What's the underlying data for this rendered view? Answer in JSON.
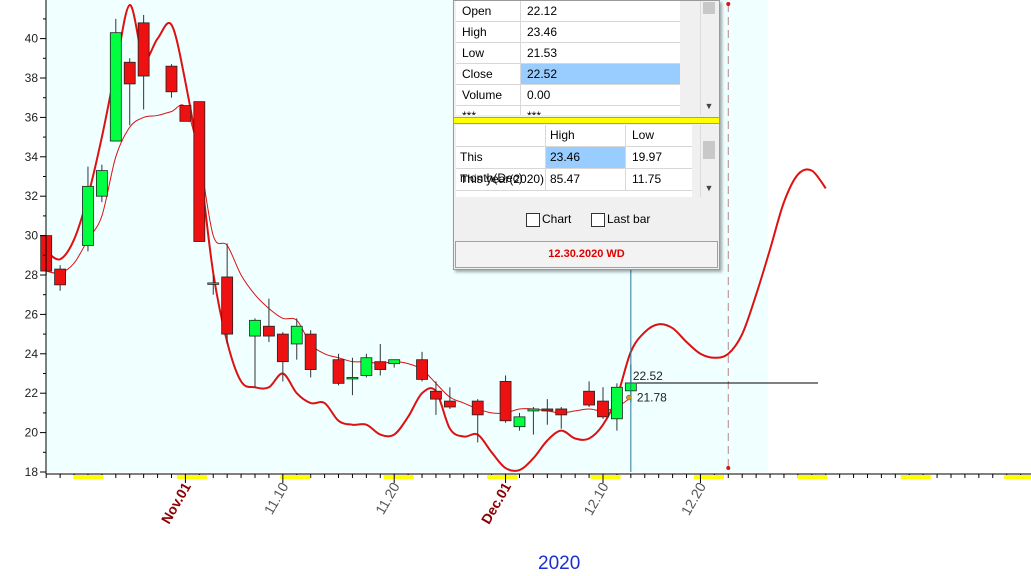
{
  "chart_data": {
    "type": "candlestick",
    "year_label": "2020",
    "yaxis": {
      "ticks": [
        18,
        20,
        22,
        24,
        26,
        28,
        30,
        32,
        34,
        36,
        38,
        40
      ],
      "ylim": [
        17.9,
        41.9
      ]
    },
    "xaxis": {
      "tick_labels": [
        {
          "label": "Nov.01",
          "color": "#8b0000",
          "day": 10
        },
        {
          "label": "11.10",
          "color": "#555555",
          "day": 17
        },
        {
          "label": "11.20",
          "color": "#555555",
          "day": 25
        },
        {
          "label": "Dec.01",
          "color": "#8b0000",
          "day": 33
        },
        {
          "label": "12.10",
          "color": "#555555",
          "day": 40
        },
        {
          "label": "12.20",
          "color": "#555555",
          "day": 47
        }
      ]
    },
    "candles": [
      {
        "day": 0,
        "o": 30.0,
        "h": 30.0,
        "l": 28.0,
        "c": 28.2
      },
      {
        "day": 1,
        "o": 28.3,
        "h": 28.5,
        "l": 27.2,
        "c": 27.5
      },
      {
        "day": 3,
        "o": 29.5,
        "h": 33.5,
        "l": 29.2,
        "c": 32.5
      },
      {
        "day": 4,
        "o": 32.0,
        "h": 33.6,
        "l": 31.7,
        "c": 33.3
      },
      {
        "day": 5,
        "o": 34.8,
        "h": 41.0,
        "l": 34.8,
        "c": 40.3
      },
      {
        "day": 6,
        "o": 38.8,
        "h": 39.0,
        "l": 35.6,
        "c": 37.7
      },
      {
        "day": 7,
        "o": 40.8,
        "h": 41.2,
        "l": 36.4,
        "c": 38.1
      },
      {
        "day": 9,
        "o": 38.6,
        "h": 38.7,
        "l": 37.0,
        "c": 37.3
      },
      {
        "day": 10,
        "o": 36.6,
        "h": 36.6,
        "l": 35.8,
        "c": 35.8
      },
      {
        "day": 11,
        "o": 36.8,
        "h": 36.8,
        "l": 29.7,
        "c": 29.7
      },
      {
        "day": 12,
        "o": 27.6,
        "h": 28.0,
        "l": 27.0,
        "c": 27.6
      },
      {
        "day": 13,
        "o": 27.9,
        "h": 29.6,
        "l": 24.5,
        "c": 25.0
      },
      {
        "day": 15,
        "o": 24.9,
        "h": 25.8,
        "l": 22.3,
        "c": 25.7
      },
      {
        "day": 16,
        "o": 25.4,
        "h": 26.8,
        "l": 24.6,
        "c": 24.9
      },
      {
        "day": 17,
        "o": 25.0,
        "h": 25.1,
        "l": 22.6,
        "c": 23.6
      },
      {
        "day": 18,
        "o": 24.5,
        "h": 25.8,
        "l": 23.7,
        "c": 25.4
      },
      {
        "day": 19,
        "o": 25.0,
        "h": 25.2,
        "l": 22.8,
        "c": 23.2
      },
      {
        "day": 21,
        "o": 23.7,
        "h": 24.0,
        "l": 22.4,
        "c": 22.5
      },
      {
        "day": 22,
        "o": 22.8,
        "h": 23.8,
        "l": 21.9,
        "c": 22.8
      },
      {
        "day": 23,
        "o": 22.9,
        "h": 24.0,
        "l": 22.8,
        "c": 23.8
      },
      {
        "day": 24,
        "o": 23.6,
        "h": 24.5,
        "l": 22.9,
        "c": 23.2
      },
      {
        "day": 25,
        "o": 23.5,
        "h": 23.7,
        "l": 23.3,
        "c": 23.7
      },
      {
        "day": 27,
        "o": 23.7,
        "h": 24.1,
        "l": 22.6,
        "c": 22.7
      },
      {
        "day": 28,
        "o": 22.1,
        "h": 22.6,
        "l": 20.9,
        "c": 21.7
      },
      {
        "day": 29,
        "o": 21.6,
        "h": 22.3,
        "l": 21.2,
        "c": 21.3
      },
      {
        "day": 31,
        "o": 21.6,
        "h": 21.7,
        "l": 19.5,
        "c": 20.9
      },
      {
        "day": 33,
        "o": 22.6,
        "h": 22.9,
        "l": 20.5,
        "c": 20.6
      },
      {
        "day": 34,
        "o": 20.3,
        "h": 21.0,
        "l": 20.1,
        "c": 20.8
      },
      {
        "day": 35,
        "o": 21.1,
        "h": 21.3,
        "l": 19.9,
        "c": 21.2
      },
      {
        "day": 36,
        "o": 21.2,
        "h": 21.7,
        "l": 20.4,
        "c": 21.1
      },
      {
        "day": 37,
        "o": 21.2,
        "h": 21.3,
        "l": 20.2,
        "c": 20.9
      },
      {
        "day": 39,
        "o": 22.1,
        "h": 22.6,
        "l": 21.3,
        "c": 21.4
      },
      {
        "day": 40,
        "o": 21.6,
        "h": 22.3,
        "l": 20.7,
        "c": 20.8
      },
      {
        "day": 41,
        "o": 20.7,
        "h": 22.5,
        "l": 20.1,
        "c": 22.3
      },
      {
        "day": 42,
        "o": 22.12,
        "h": 23.46,
        "l": 21.53,
        "c": 22.52
      }
    ],
    "series": [
      {
        "values_xy": [
          [
            0,
            29.2
          ],
          [
            1,
            28.8
          ],
          [
            2,
            29.8
          ],
          [
            3,
            32.0
          ],
          [
            4,
            35.0
          ],
          [
            5,
            38.5
          ],
          [
            6,
            41.7
          ],
          [
            7,
            39.0
          ],
          [
            8,
            40.0
          ],
          [
            9,
            40.7
          ],
          [
            10,
            37.8
          ],
          [
            11,
            33.7
          ],
          [
            12,
            28.1
          ],
          [
            13,
            24.6
          ],
          [
            14,
            22.6
          ],
          [
            15,
            22.3
          ],
          [
            16,
            22.3
          ],
          [
            17,
            23.0
          ],
          [
            18,
            22.0
          ],
          [
            19,
            21.5
          ],
          [
            20,
            21.5
          ],
          [
            21,
            20.6
          ],
          [
            22,
            20.4
          ],
          [
            23,
            20.4
          ],
          [
            24,
            19.9
          ],
          [
            25,
            19.9
          ],
          [
            26,
            20.8
          ],
          [
            27,
            22.0
          ],
          [
            28,
            22.1
          ],
          [
            29,
            20.2
          ],
          [
            30,
            19.8
          ],
          [
            31,
            19.9
          ],
          [
            32,
            19.0
          ],
          [
            33,
            18.2
          ],
          [
            34,
            18.1
          ],
          [
            35,
            18.7
          ],
          [
            36,
            19.6
          ],
          [
            37,
            20.1
          ],
          [
            38,
            19.7
          ],
          [
            39,
            19.7
          ],
          [
            40,
            20.4
          ],
          [
            41,
            21.8
          ],
          [
            42,
            24.1
          ],
          [
            43,
            25.1
          ],
          [
            44,
            25.5
          ],
          [
            45,
            25.3
          ],
          [
            46,
            24.6
          ],
          [
            47,
            24.0
          ],
          [
            48,
            23.8
          ],
          [
            49,
            24.0
          ],
          [
            50,
            25.0
          ],
          [
            51,
            27.0
          ],
          [
            52,
            29.3
          ],
          [
            53,
            31.7
          ],
          [
            54,
            33.1
          ],
          [
            55,
            33.3
          ],
          [
            56,
            32.4
          ]
        ]
      },
      {
        "values_xy": [
          [
            0,
            28.2
          ],
          [
            1,
            28.1
          ],
          [
            2,
            28.6
          ],
          [
            3,
            29.8
          ],
          [
            4,
            31.0
          ],
          [
            5,
            34.0
          ],
          [
            6,
            35.5
          ],
          [
            7,
            36.0
          ],
          [
            8,
            36.1
          ],
          [
            9,
            36.3
          ],
          [
            10,
            36.5
          ],
          [
            11,
            34.0
          ],
          [
            12,
            30.0
          ],
          [
            13,
            29.5
          ],
          [
            14,
            28.0
          ],
          [
            15,
            27.0
          ],
          [
            16,
            26.3
          ],
          [
            17,
            25.8
          ],
          [
            18,
            25.7
          ],
          [
            19,
            24.5
          ],
          [
            20,
            24.0
          ],
          [
            21,
            23.8
          ],
          [
            22,
            23.6
          ],
          [
            23,
            23.6
          ],
          [
            24,
            23.5
          ],
          [
            25,
            23.6
          ],
          [
            26,
            23.5
          ],
          [
            27,
            23.2
          ],
          [
            28,
            22.5
          ],
          [
            29,
            21.8
          ],
          [
            30,
            21.5
          ],
          [
            31,
            21.2
          ],
          [
            32,
            21.0
          ],
          [
            33,
            21.0
          ],
          [
            34,
            21.2
          ],
          [
            35,
            21.2
          ],
          [
            36,
            21.1
          ],
          [
            37,
            21.0
          ],
          [
            38,
            21.1
          ],
          [
            39,
            21.2
          ],
          [
            40,
            21.1
          ],
          [
            41,
            21.3
          ],
          [
            42,
            21.78
          ]
        ]
      }
    ],
    "markers": {
      "cursor_day": 42,
      "forecast_day": 49
    },
    "labels": {
      "close": "22.52",
      "avg": "21.78"
    }
  },
  "panel": {
    "ohlc_rows": [
      {
        "label": "Open",
        "value": "22.12"
      },
      {
        "label": "High",
        "value": "23.46"
      },
      {
        "label": "Low",
        "value": "21.53"
      },
      {
        "label": "Close",
        "value": "22.52"
      },
      {
        "label": "Volume",
        "value": "0.00"
      },
      {
        "label": "***",
        "value": "***"
      }
    ],
    "range_header": {
      "high": "High",
      "low": "Low"
    },
    "range_rows": [
      {
        "period": "This month(Dec)",
        "high": "23.46",
        "low": "19.97"
      },
      {
        "period": "This year(2020)",
        "high": "85.47",
        "low": "11.75"
      }
    ],
    "chart_checkbox_label": "Chart",
    "lastbar_checkbox_label": "Last bar",
    "date_label": "12.30.2020 WD"
  },
  "colors": {
    "up": "#00ff40",
    "down": "#ee1111",
    "line": "#dd1111",
    "cursor": "#2a7a9a",
    "plot_bg": "#f0ffff",
    "weekend": "#ffff00"
  }
}
